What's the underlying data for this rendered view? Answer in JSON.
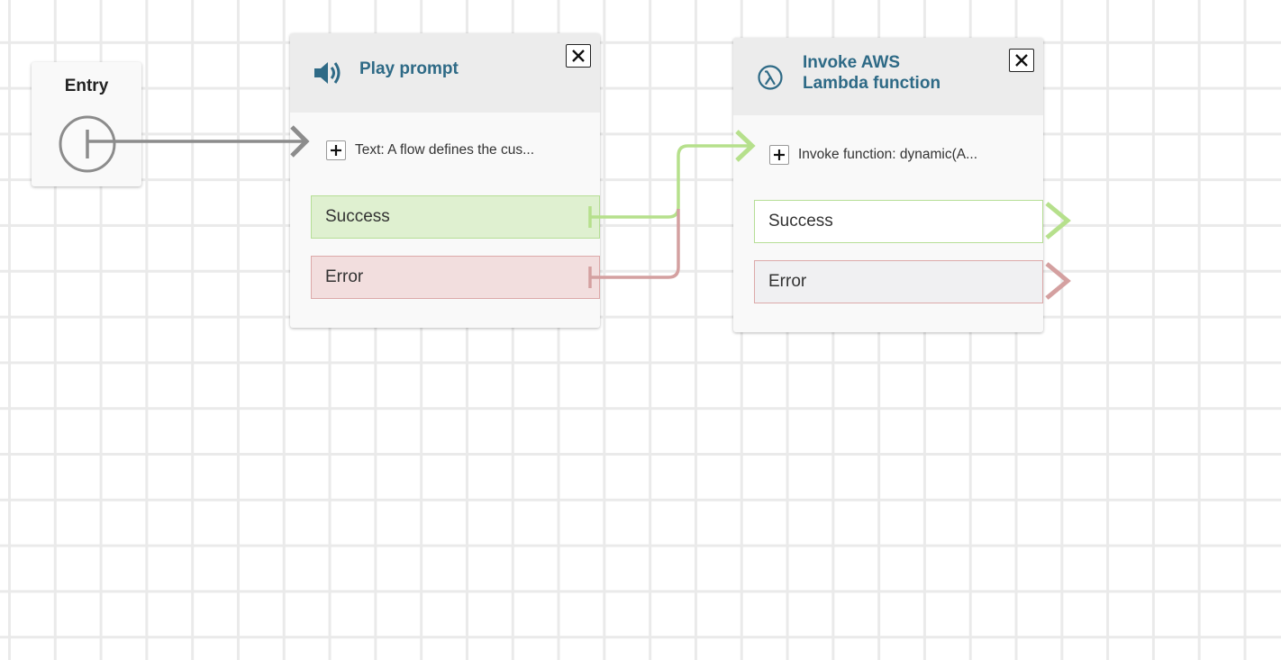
{
  "entry": {
    "label": "Entry"
  },
  "play_prompt": {
    "title": "Play prompt",
    "param_text": "Text: A flow defines the cus...",
    "branches": {
      "success": "Success",
      "error": "Error"
    }
  },
  "lambda": {
    "title_line1": "Invoke AWS",
    "title_line2": "Lambda function",
    "param_text": "Invoke function: dynamic(A...",
    "branches": {
      "success": "Success",
      "error": "Error"
    }
  },
  "colors": {
    "title": "#2e6a86",
    "success": "#b6e08c",
    "error": "#d4a0a0",
    "entry_connector": "#8c8c8c"
  },
  "icons": {
    "play_prompt": "speaker-icon",
    "lambda": "lambda-icon",
    "close": "close-icon",
    "add": "plus-icon"
  }
}
